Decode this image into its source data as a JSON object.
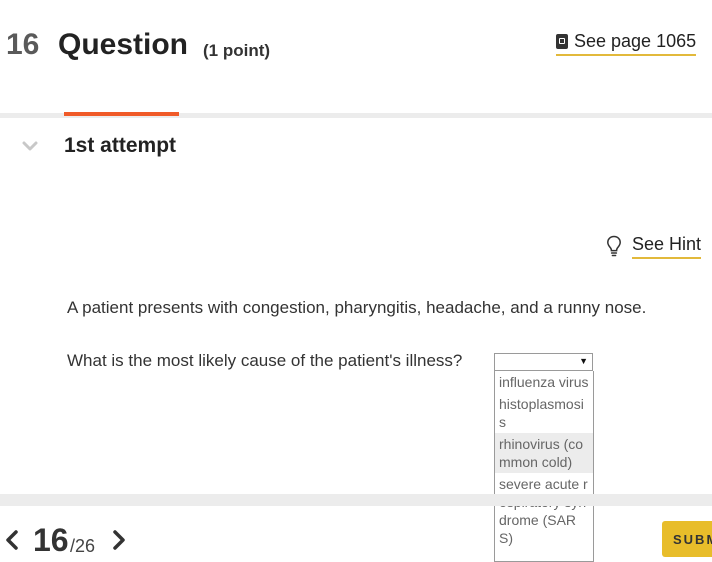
{
  "header": {
    "question_number": "16",
    "question_label": "Question",
    "points": "(1 point)",
    "see_page": "See page 1065"
  },
  "attempt": {
    "label": "1st attempt"
  },
  "hint": {
    "label": "See Hint"
  },
  "question": {
    "text": "A patient presents with congestion, pharyngitis, headache, and a runny nose.",
    "prompt": "What is the most likely cause of the patient's illness?"
  },
  "dropdown": {
    "selected": "",
    "options": [
      "influenza virus",
      "histoplasmosis",
      "rhinovirus (common cold)",
      "severe acute respiratory syndrome (SARS)"
    ],
    "highlighted_index": 2
  },
  "footer": {
    "current_page": "16",
    "total_pages": "/26",
    "submit_label": "SUBMIT"
  },
  "colors": {
    "accent_orange": "#f05a28",
    "accent_yellow": "#e8bd2a",
    "divider": "#ececec"
  }
}
